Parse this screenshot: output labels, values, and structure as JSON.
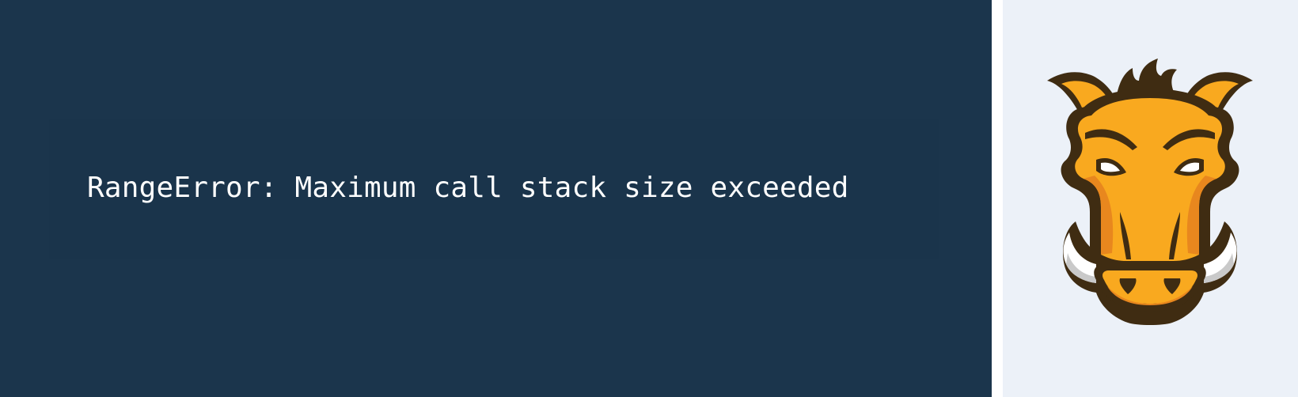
{
  "error": {
    "message": "RangeError: Maximum call stack size exceeded"
  },
  "logo": {
    "icon": "grunt-boar-logo-icon",
    "colors": {
      "outline": "#3f2c12",
      "fur": "#f9a91f",
      "shade": "#e8871e",
      "tusk": "#ffffff",
      "tusk_shade": "#c9c9c9"
    }
  },
  "colors": {
    "error_background": "#1b354c",
    "error_text": "#ffffff",
    "logo_panel_background": "#ecf1f8"
  }
}
